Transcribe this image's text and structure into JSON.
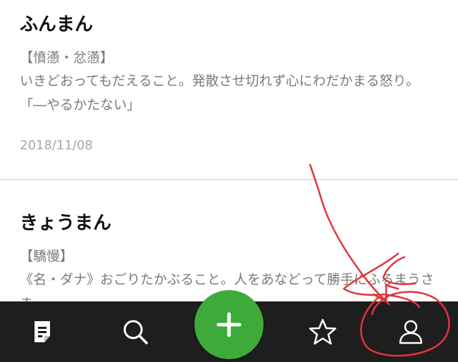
{
  "entries": [
    {
      "word": "ふんまん",
      "kanji": "【憤懣・忿懣】",
      "meaning": "いきどおってもだえること。発散させ切れず心にわだかまる怒り。 「―やるかたない」",
      "date": "2018/11/08"
    },
    {
      "word": "きょうまん",
      "kanji": "【驕慢】",
      "meaning": "《名・ダナ》おごりたかぶること。人をあなどって勝手にふるまうさま。"
    }
  ],
  "tabbar": {
    "icons": [
      "note-icon",
      "search-icon",
      "plus-icon",
      "star-icon",
      "user-icon"
    ],
    "background": "#1e1e1e",
    "fab_color": "#3daa3a"
  },
  "annotation": {
    "color": "#e0343c"
  }
}
